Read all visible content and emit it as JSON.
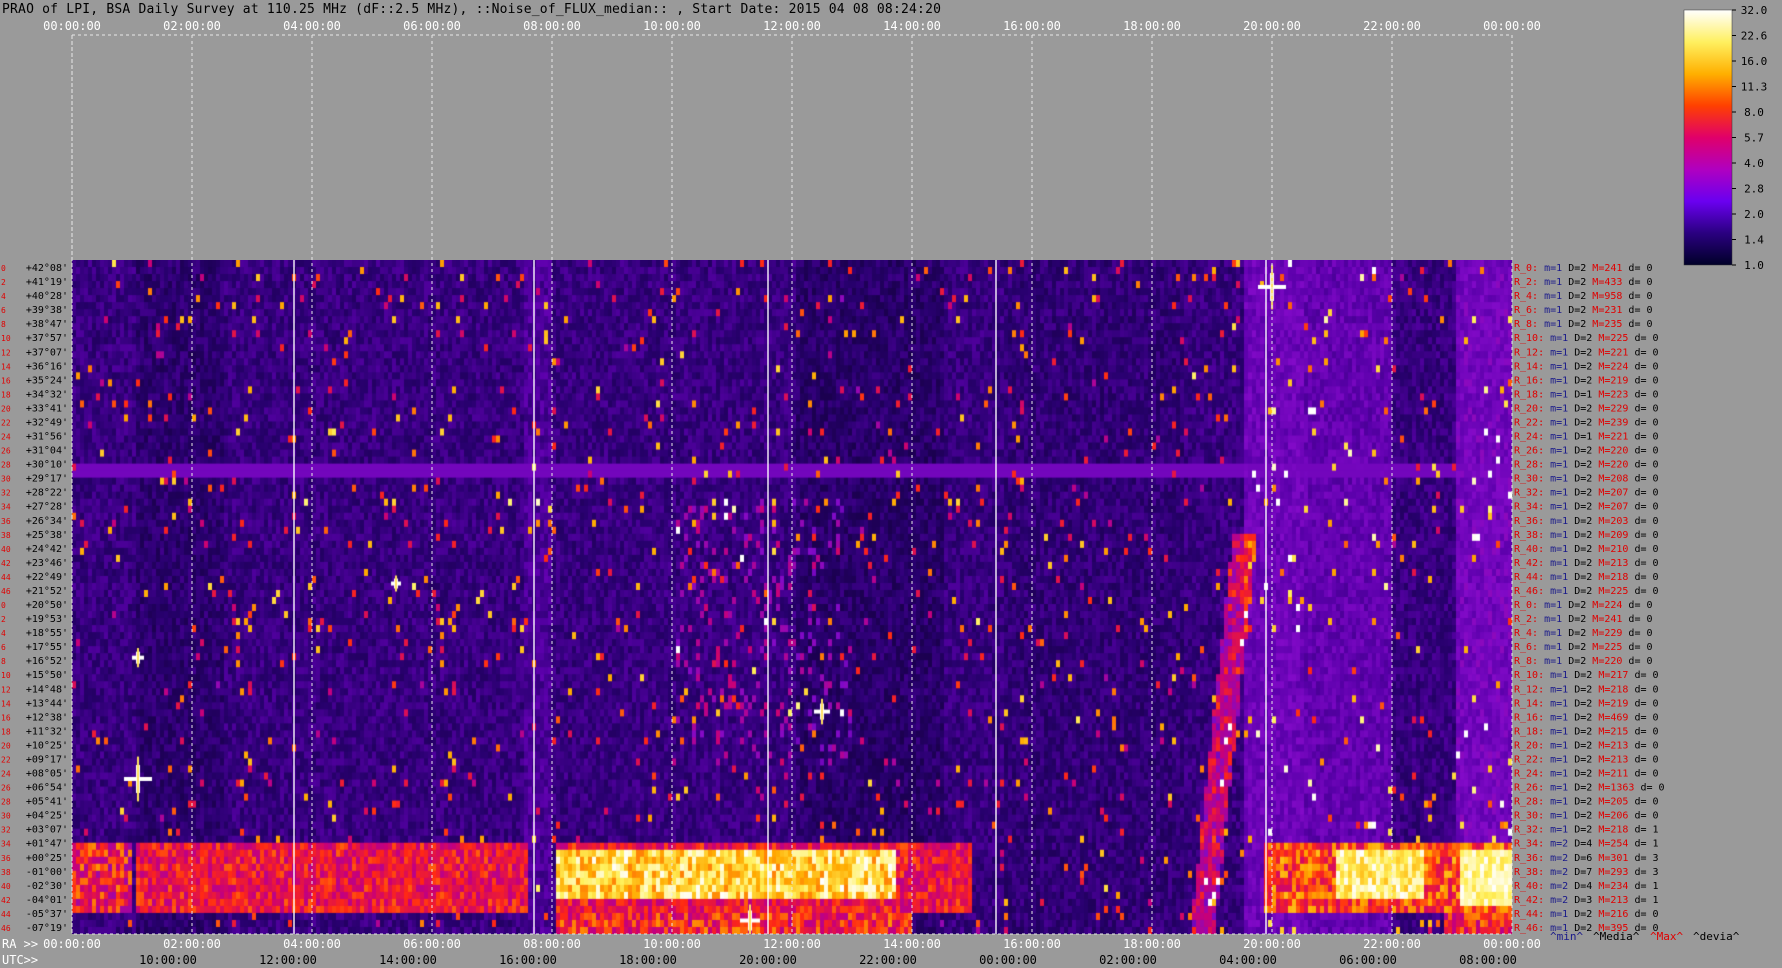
{
  "title": "PRAO of LPI, BSA Daily Survey at 110.25 MHz (dF::2.5 MHz), ::Noise_of_FLUX_median:: , Start Date: 2015 04 08 08:24:20",
  "colorbar": {
    "ticks": [
      "32.0",
      "22.6",
      "16.0",
      "11.3",
      "8.0",
      "5.7",
      "4.0",
      "2.8",
      "2.0",
      "1.4",
      "1.0"
    ],
    "colors": [
      "#ffffff",
      "#fff060",
      "#ffb000",
      "#ff4000",
      "#e0006a",
      "#b000c0",
      "#6a00f0",
      "#2a0080",
      "#000028"
    ]
  },
  "footer_legend": [
    {
      "label": "^min^",
      "color": "#1a1a8a"
    },
    {
      "label": "^Media^",
      "color": "#000000"
    },
    {
      "label": "^Max^",
      "color": "#e00000"
    },
    {
      "label": "^devia^",
      "color": "#000000"
    }
  ],
  "chart_data": {
    "type": "heatmap",
    "top_axis_labels": [
      "00:00:00",
      "02:00:00",
      "04:00:00",
      "06:00:00",
      "08:00:00",
      "10:00:00",
      "12:00:00",
      "14:00:00",
      "16:00:00",
      "18:00:00",
      "20:00:00",
      "22:00:00",
      "00:00:00"
    ],
    "ra_label": "RA >>",
    "ra_labels": [
      "00:00:00",
      "02:00:00",
      "04:00:00",
      "06:00:00",
      "08:00:00",
      "10:00:00",
      "12:00:00",
      "14:00:00",
      "16:00:00",
      "18:00:00",
      "20:00:00",
      "22:00:00",
      "00:00:00"
    ],
    "utc_label": "UTC>>",
    "utc_labels": [
      "10:00:00",
      "12:00:00",
      "14:00:00",
      "16:00:00",
      "18:00:00",
      "20:00:00",
      "22:00:00",
      "00:00:00",
      "02:00:00",
      "04:00:00",
      "06:00:00",
      "08:00:00"
    ],
    "dec_labels": [
      "+42°08'",
      "+41°19'",
      "+40°28'",
      "+39°38'",
      "+38°47'",
      "+37°57'",
      "+37°07'",
      "+36°16'",
      "+35°24'",
      "+34°32'",
      "+33°41'",
      "+32°49'",
      "+31°56'",
      "+31°04'",
      "+30°10'",
      "+29°17'",
      "+28°22'",
      "+27°28'",
      "+26°34'",
      "+25°38'",
      "+24°42'",
      "+23°46'",
      "+22°49'",
      "+21°52'",
      "+20°50'",
      "+19°53'",
      "+18°55'",
      "+17°55'",
      "+16°52'",
      "+15°50'",
      "+14°48'",
      "+13°44'",
      "+12°38'",
      "+11°32'",
      "+10°25'",
      "+09°17'",
      "+08°05'",
      "+06°54'",
      "+05°41'",
      "+04°25'",
      "+03°07'",
      "+01°47'",
      "+00°25'",
      "-01°00'",
      "-02°30'",
      "-04°01'",
      "-05°37'",
      "-07°19'"
    ],
    "beam_stats": [
      {
        "beam": "R_0:",
        "min": "1",
        "median": "2",
        "max": "241",
        "dev": "0"
      },
      {
        "beam": "R_2:",
        "min": "1",
        "median": "2",
        "max": "433",
        "dev": "0"
      },
      {
        "beam": "R_4:",
        "min": "1",
        "median": "2",
        "max": "958",
        "dev": "0"
      },
      {
        "beam": "R_6:",
        "min": "1",
        "median": "2",
        "max": "231",
        "dev": "0"
      },
      {
        "beam": "R_8:",
        "min": "1",
        "median": "2",
        "max": "235",
        "dev": "0"
      },
      {
        "beam": "R_10:",
        "min": "1",
        "median": "2",
        "max": "225",
        "dev": "0"
      },
      {
        "beam": "R_12:",
        "min": "1",
        "median": "2",
        "max": "221",
        "dev": "0"
      },
      {
        "beam": "R_14:",
        "min": "1",
        "median": "2",
        "max": "224",
        "dev": "0"
      },
      {
        "beam": "R_16:",
        "min": "1",
        "median": "2",
        "max": "219",
        "dev": "0"
      },
      {
        "beam": "R_18:",
        "min": "1",
        "median": "1",
        "max": "223",
        "dev": "0"
      },
      {
        "beam": "R_20:",
        "min": "1",
        "median": "2",
        "max": "229",
        "dev": "0"
      },
      {
        "beam": "R_22:",
        "min": "1",
        "median": "2",
        "max": "239",
        "dev": "0"
      },
      {
        "beam": "R_24:",
        "min": "1",
        "median": "1",
        "max": "221",
        "dev": "0"
      },
      {
        "beam": "R_26:",
        "min": "1",
        "median": "2",
        "max": "220",
        "dev": "0"
      },
      {
        "beam": "R_28:",
        "min": "1",
        "median": "2",
        "max": "220",
        "dev": "0"
      },
      {
        "beam": "R_30:",
        "min": "1",
        "median": "2",
        "max": "208",
        "dev": "0"
      },
      {
        "beam": "R_32:",
        "min": "1",
        "median": "2",
        "max": "207",
        "dev": "0"
      },
      {
        "beam": "R_34:",
        "min": "1",
        "median": "2",
        "max": "207",
        "dev": "0"
      },
      {
        "beam": "R_36:",
        "min": "1",
        "median": "2",
        "max": "203",
        "dev": "0"
      },
      {
        "beam": "R_38:",
        "min": "1",
        "median": "2",
        "max": "209",
        "dev": "0"
      },
      {
        "beam": "R_40:",
        "min": "1",
        "median": "2",
        "max": "210",
        "dev": "0"
      },
      {
        "beam": "R_42:",
        "min": "1",
        "median": "2",
        "max": "213",
        "dev": "0"
      },
      {
        "beam": "R_44:",
        "min": "1",
        "median": "2",
        "max": "218",
        "dev": "0"
      },
      {
        "beam": "R_46:",
        "min": "1",
        "median": "2",
        "max": "225",
        "dev": "0"
      },
      {
        "beam": "R_0:",
        "min": "1",
        "median": "2",
        "max": "224",
        "dev": "0"
      },
      {
        "beam": "R_2:",
        "min": "1",
        "median": "2",
        "max": "241",
        "dev": "0"
      },
      {
        "beam": "R_4:",
        "min": "1",
        "median": "2",
        "max": "229",
        "dev": "0"
      },
      {
        "beam": "R_6:",
        "min": "1",
        "median": "2",
        "max": "225",
        "dev": "0"
      },
      {
        "beam": "R_8:",
        "min": "1",
        "median": "2",
        "max": "220",
        "dev": "0"
      },
      {
        "beam": "R_10:",
        "min": "1",
        "median": "2",
        "max": "217",
        "dev": "0"
      },
      {
        "beam": "R_12:",
        "min": "1",
        "median": "2",
        "max": "218",
        "dev": "0"
      },
      {
        "beam": "R_14:",
        "min": "1",
        "median": "2",
        "max": "219",
        "dev": "0"
      },
      {
        "beam": "R_16:",
        "min": "1",
        "median": "2",
        "max": "469",
        "dev": "0"
      },
      {
        "beam": "R_18:",
        "min": "1",
        "median": "2",
        "max": "215",
        "dev": "0"
      },
      {
        "beam": "R_20:",
        "min": "1",
        "median": "2",
        "max": "213",
        "dev": "0"
      },
      {
        "beam": "R_22:",
        "min": "1",
        "median": "2",
        "max": "213",
        "dev": "0"
      },
      {
        "beam": "R_24:",
        "min": "1",
        "median": "2",
        "max": "211",
        "dev": "0"
      },
      {
        "beam": "R_26:",
        "min": "1",
        "median": "2",
        "max": "1363",
        "dev": "0"
      },
      {
        "beam": "R_28:",
        "min": "1",
        "median": "2",
        "max": "205",
        "dev": "0"
      },
      {
        "beam": "R_30:",
        "min": "1",
        "median": "2",
        "max": "206",
        "dev": "0"
      },
      {
        "beam": "R_32:",
        "min": "1",
        "median": "2",
        "max": "218",
        "dev": "1"
      },
      {
        "beam": "R_34:",
        "min": "2",
        "median": "4",
        "max": "254",
        "dev": "1"
      },
      {
        "beam": "R_36:",
        "min": "2",
        "median": "6",
        "max": "301",
        "dev": "3"
      },
      {
        "beam": "R_38:",
        "min": "2",
        "median": "7",
        "max": "293",
        "dev": "3"
      },
      {
        "beam": "R_40:",
        "min": "2",
        "median": "4",
        "max": "234",
        "dev": "1"
      },
      {
        "beam": "R_42:",
        "min": "2",
        "median": "3",
        "max": "213",
        "dev": "1"
      },
      {
        "beam": "R_44:",
        "min": "1",
        "median": "2",
        "max": "216",
        "dev": "0"
      },
      {
        "beam": "R_46:",
        "min": "1",
        "median": "2",
        "max": "395",
        "dev": "0"
      }
    ]
  }
}
